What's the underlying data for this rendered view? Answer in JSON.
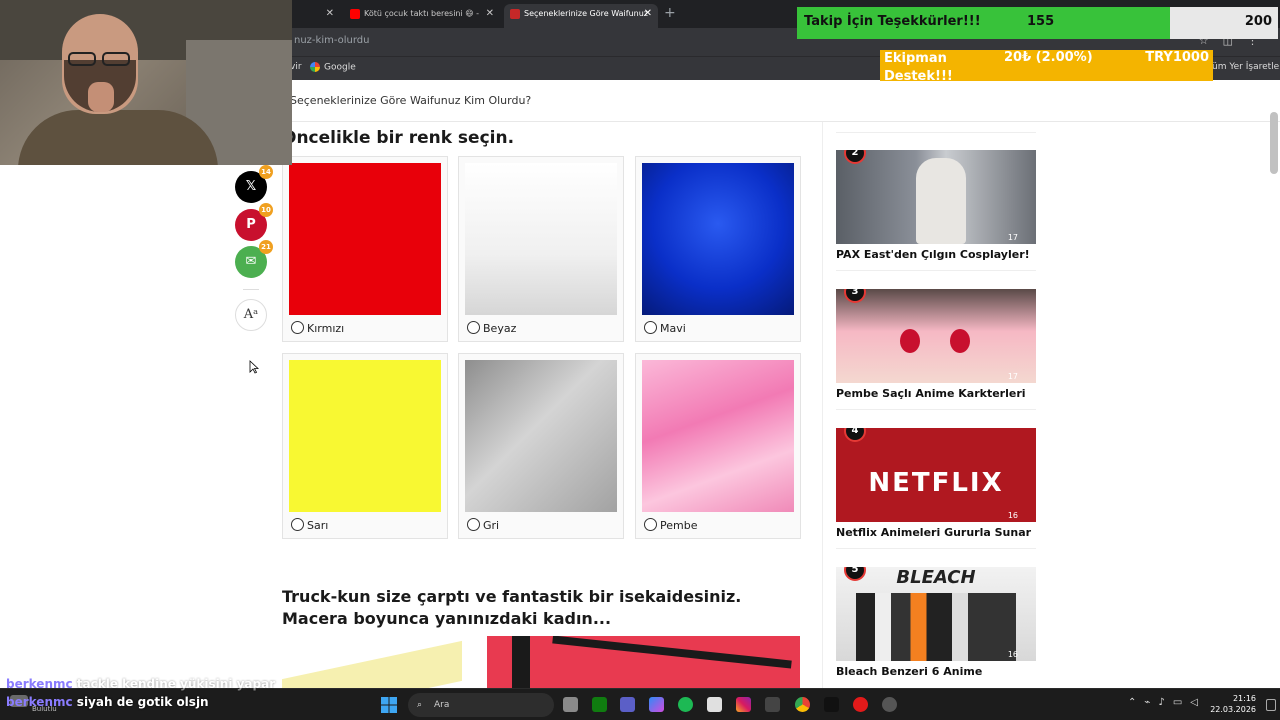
{
  "browser": {
    "tabs": [
      {
        "label": "Kötü çocuk taktı beresini 😄 -"
      },
      {
        "label": "Seçeneklerinize Göre Waifunuz"
      }
    ],
    "new_tab": "+",
    "url": "nuz-kim-olurdu",
    "bookmarks": {
      "partial": "vir",
      "google": "Google",
      "all": "üm Yer İşaretleri"
    }
  },
  "page": {
    "header_title": "Seçeneklerinize Göre Waifunuz Kim Olurdu?",
    "question1": "Öncelikle bir renk seçin.",
    "options": [
      {
        "label": "Kırmızı",
        "color": "#e8000a"
      },
      {
        "label": "Beyaz",
        "color": "#f4f4f4"
      },
      {
        "label": "Mavi",
        "color": "#0a2fc8"
      },
      {
        "label": "Sarı",
        "color": "#f8f832"
      },
      {
        "label": "Gri",
        "color": "#b0b0b0"
      },
      {
        "label": "Pembe",
        "color": "#f59ac4"
      }
    ],
    "question2": "Truck-kun size çarptı ve fantastik bir isekaidesiniz. Macera boyunca yanınızdaki kadın..."
  },
  "share": {
    "x": {
      "icon": "x-logo-icon",
      "count": "14"
    },
    "pinterest": {
      "icon": "pinterest-icon",
      "count": "10"
    },
    "email": {
      "icon": "email-icon",
      "count": "21"
    },
    "font": "Aᵃ"
  },
  "sidebar": {
    "items": [
      {
        "rank": "2",
        "title": "PAX East'den Çılgın Cosplayler!",
        "count": "17"
      },
      {
        "rank": "3",
        "title": "Pembe Saçlı Anime Karkterleri",
        "count": "17"
      },
      {
        "rank": "4",
        "title": "Netflix Animeleri Gururla Sunar",
        "count": "16"
      },
      {
        "rank": "5",
        "title": "Bleach Benzeri 6 Anime",
        "count": "16"
      }
    ]
  },
  "overlay": {
    "follow_label": "Takip İçin Teşekkürler!!!",
    "follow_current": "155",
    "follow_goal": "200",
    "follow_progress": 0.775,
    "donate_label": "Ekipman Destek!!!",
    "donate_amount": "20₺ (2.00%)",
    "donate_goal": "TRY1000"
  },
  "chat": [
    {
      "user": "berkenmc",
      "message": "tackle kendine yükisini yapar"
    },
    {
      "user": "berkenmc",
      "message": "siyah de gotik olsjn"
    }
  ],
  "taskbar": {
    "search_placeholder": "Ara",
    "weather": "Bulutlu",
    "time": "21:16",
    "date": "22.03.2026"
  }
}
